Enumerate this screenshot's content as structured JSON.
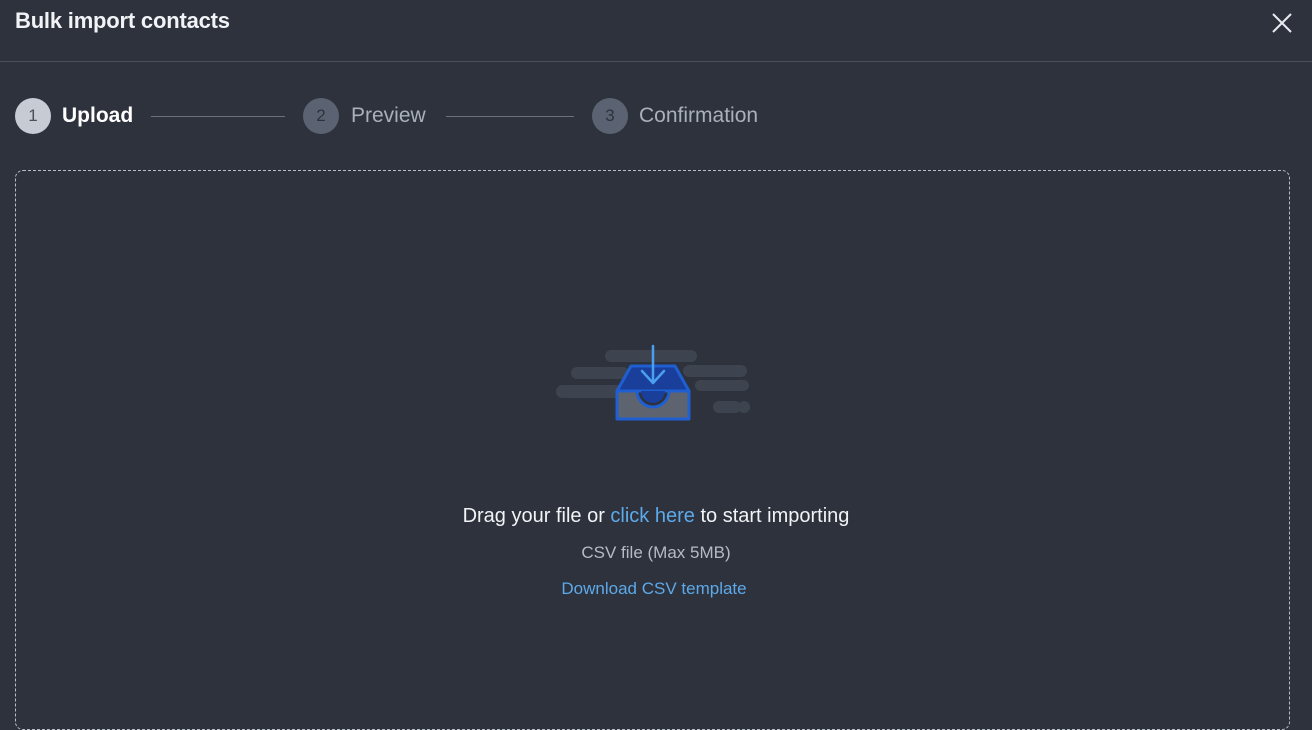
{
  "dialog": {
    "title": "Bulk import contacts",
    "close_icon": "close-icon"
  },
  "steps": [
    {
      "number": "1",
      "label": "Upload",
      "state": "active"
    },
    {
      "number": "2",
      "label": "Preview",
      "state": "inactive"
    },
    {
      "number": "3",
      "label": "Confirmation",
      "state": "inactive"
    }
  ],
  "dropzone": {
    "icon": "inbox-download-icon",
    "text_before": "Drag your file or ",
    "link_text": "click here",
    "text_after": " to start importing",
    "file_hint": "CSV file (Max 5MB)",
    "download_link": "Download CSV template"
  },
  "colors": {
    "background": "#2d323c",
    "accent_link": "#5da9ea",
    "icon_blue": "#1f5fd1"
  }
}
